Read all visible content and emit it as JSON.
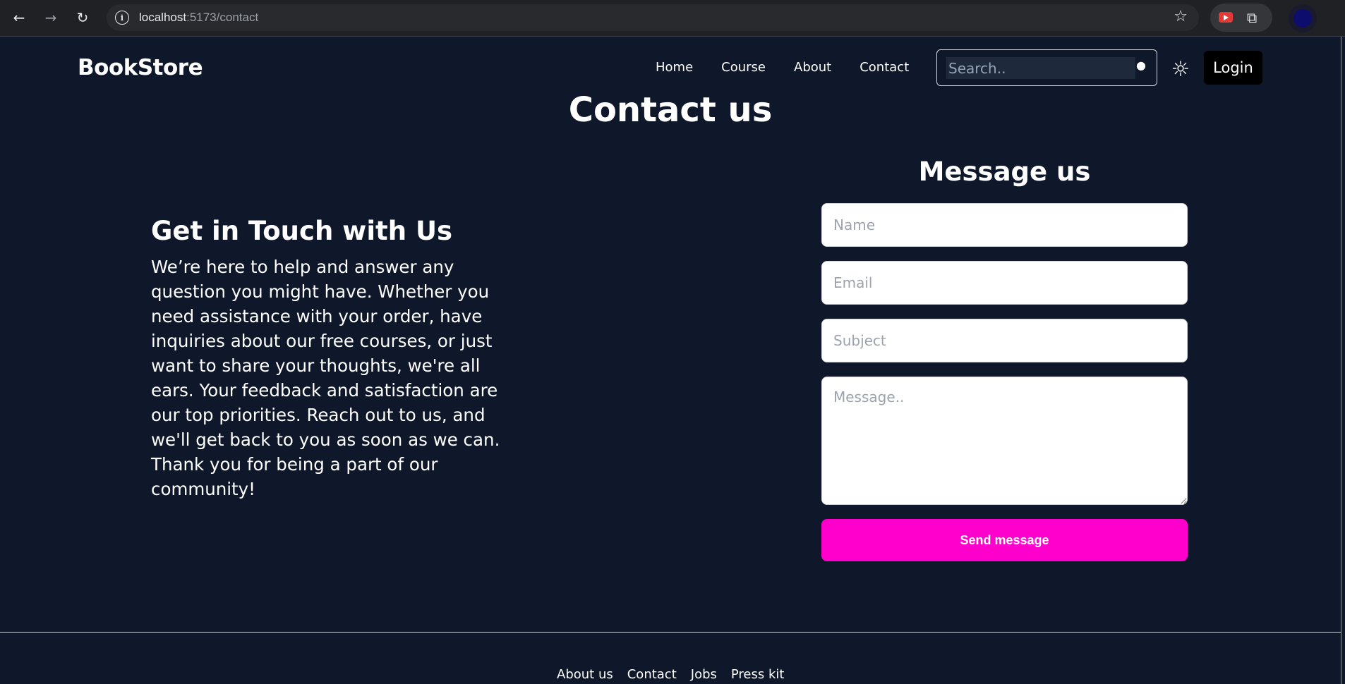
{
  "browser": {
    "url_host": "localhost",
    "url_path": ":5173/contact"
  },
  "header": {
    "logo": "BookStore",
    "nav": [
      "Home",
      "Course",
      "About",
      "Contact"
    ],
    "search_placeholder": "Search..",
    "login_label": "Login"
  },
  "page_title": "Contact us",
  "info": {
    "title": "Get in Touch with Us",
    "text": "We’re here to help and answer any question you might have. Whether you need assistance with your order, have inquiries about our free courses, or just want to share your thoughts, we're all ears. Your feedback and satisfaction are our top priorities. Reach out to us, and we'll get back to you as soon as we can. Thank you for being a part of our community!"
  },
  "form": {
    "title": "Message us",
    "name_placeholder": "Name",
    "email_placeholder": "Email",
    "subject_placeholder": "Subject",
    "message_placeholder": "Message..",
    "submit_label": "Send message"
  },
  "footer": {
    "links": [
      "About us",
      "Contact",
      "Jobs",
      "Press kit"
    ]
  },
  "colors": {
    "background": "#0f172a",
    "accent": "#ff00cc"
  }
}
